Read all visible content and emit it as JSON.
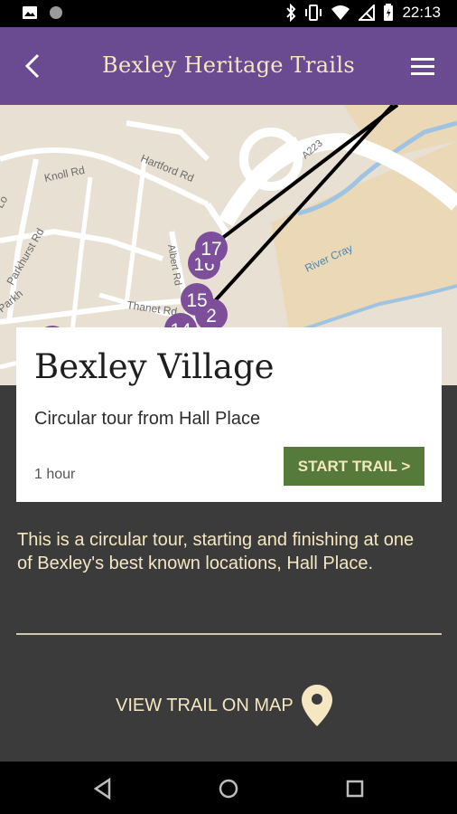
{
  "status_bar": {
    "time": "22:13",
    "icons": [
      "image-icon",
      "notification-dot-icon",
      "bluetooth-icon",
      "vibrate-icon",
      "wifi-icon",
      "no-signal-icon",
      "battery-icon"
    ]
  },
  "app_bar": {
    "title": "Bexley Heritage Trails",
    "back_icon": "back-chevron-icon",
    "menu_icon": "hamburger-menu-icon"
  },
  "map": {
    "road_labels": [
      "Knoll Rd",
      "Hartford Rd",
      "Parkhurst Rd",
      "Albert Rd",
      "Thanet Rd",
      "A223",
      "River Cray",
      "Lo",
      "Parkh"
    ],
    "markers": [
      "17",
      "16",
      "15",
      "14",
      "2"
    ]
  },
  "trail_card": {
    "title": "Bexley Village",
    "subtitle": "Circular tour from Hall Place",
    "duration": "1 hour",
    "start_button": "START TRAIL >"
  },
  "description": "This is a circular tour, starting and finishing at one of Bexley's best known locations, Hall Place.",
  "view_map_label": "VIEW TRAIL ON MAP",
  "colors": {
    "app_bar": "#6a4b91",
    "accent_text": "#f4e7c2",
    "button": "#567a3a",
    "background": "#3b3b3b",
    "marker": "#7d4e9a"
  }
}
